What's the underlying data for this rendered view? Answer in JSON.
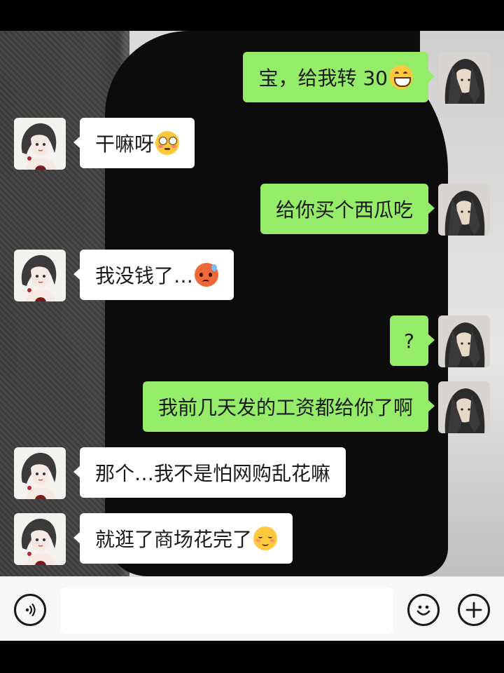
{
  "messages": [
    {
      "side": "me",
      "text": "宝，给我转 30",
      "emoji": "grin-face"
    },
    {
      "side": "other",
      "text": "干嘛呀",
      "emoji": "flushed-face"
    },
    {
      "side": "me",
      "text": "给你买个西瓜吃",
      "emoji": ""
    },
    {
      "side": "other",
      "text": "我没钱了…",
      "emoji": "sweat-face"
    },
    {
      "side": "me",
      "text": "?",
      "emoji": ""
    },
    {
      "side": "me",
      "text": "我前几天发的工资都给你了啊",
      "emoji": ""
    },
    {
      "side": "other",
      "text": "那个…我不是怕网购乱花嘛",
      "emoji": ""
    },
    {
      "side": "other",
      "text": "就逛了商场花完了",
      "emoji": "blush-face"
    }
  ],
  "input_bar": {
    "text_value": "",
    "voice_icon": "voice-icon",
    "emoji_icon": "smiley-icon",
    "plus_icon": "plus-icon"
  },
  "colors": {
    "my_bubble": "#95ec69",
    "other_bubble": "#ffffff",
    "input_bar_bg": "#f7f7f7"
  }
}
